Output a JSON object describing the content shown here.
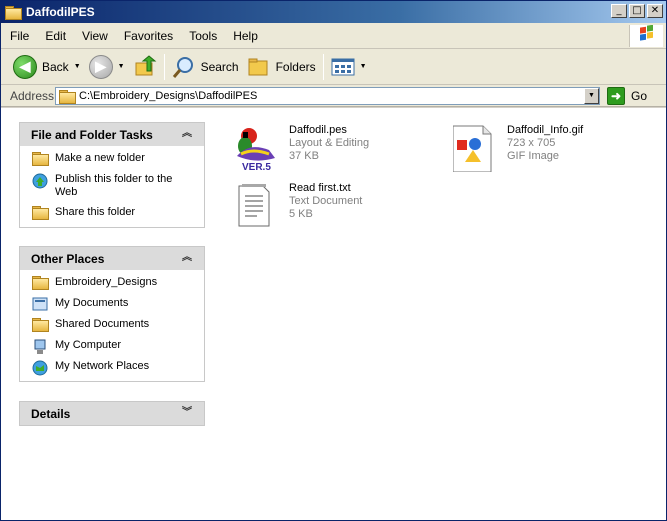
{
  "window": {
    "title": "DaffodilPES"
  },
  "menu": [
    "File",
    "Edit",
    "View",
    "Favorites",
    "Tools",
    "Help"
  ],
  "toolbar": {
    "back": "Back",
    "search": "Search",
    "folders": "Folders"
  },
  "address": {
    "label": "Address",
    "value": "C:\\Embroidery_Designs\\DaffodilPES",
    "go": "Go"
  },
  "tasks_panel": {
    "title": "File and Folder Tasks",
    "items": [
      "Make a new folder",
      "Publish this folder to the Web",
      "Share this folder"
    ]
  },
  "places_panel": {
    "title": "Other Places",
    "items": [
      "Embroidery_Designs",
      "My Documents",
      "Shared Documents",
      "My Computer",
      "My Network Places"
    ]
  },
  "details_panel": {
    "title": "Details"
  },
  "files": [
    {
      "name": "Daffodil.pes",
      "type": "Layout & Editing",
      "size": "37 KB",
      "badge": "VER.5"
    },
    {
      "name": "Daffodil_Info.gif",
      "type": "723 x 705",
      "size": "GIF Image"
    },
    {
      "name": "Read first.txt",
      "type": "Text Document",
      "size": "5 KB"
    }
  ],
  "colors": {
    "title_start": "#0a246a",
    "title_end": "#a6caf0",
    "panel_header": "#dbdbdb",
    "go_green": "#2e9c1e"
  }
}
